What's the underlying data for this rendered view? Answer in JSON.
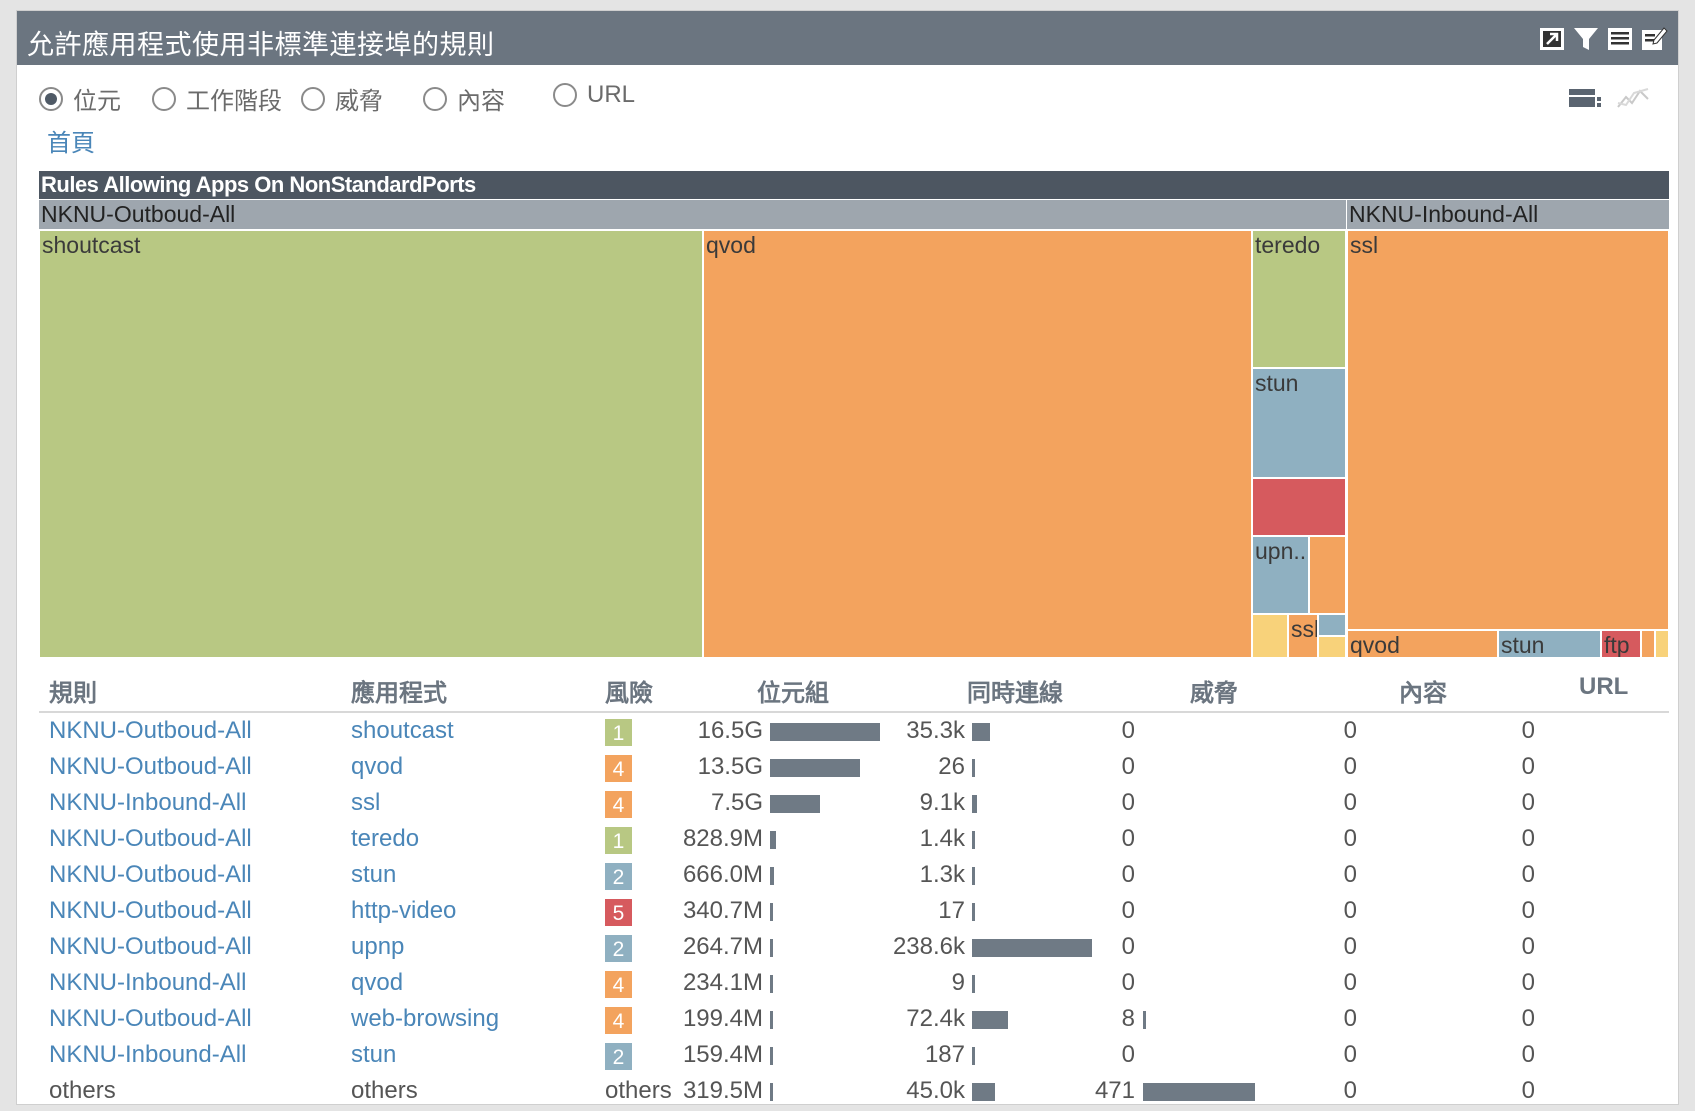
{
  "window": {
    "title": "允許應用程式使用非標準連接埠的規則",
    "icons": [
      "expand-icon",
      "filter-icon",
      "list-icon",
      "edit-icon"
    ]
  },
  "radios": {
    "options": [
      "位元",
      "工作階段",
      "威脅",
      "內容",
      "URL"
    ],
    "selected": "位元"
  },
  "view_icons": [
    "table-view-icon",
    "line-chart-icon"
  ],
  "breadcrumb": {
    "home": "首頁"
  },
  "treemap": {
    "title": "Rules Allowing Apps On NonStandardPorts",
    "groups": [
      "NKNU-Outboud-All",
      "NKNU-Inbound-All"
    ],
    "cell_labels": {
      "shoutcast": "shoutcast",
      "qvod": "qvod",
      "teredo": "teredo",
      "stun": "stun",
      "upnp": "upn..",
      "ssl_small": "ssl",
      "ssl": "ssl",
      "qvod_in": "qvod",
      "stun_in": "stun",
      "ftp": "ftp"
    },
    "colors": {
      "risk1": "#b8c883",
      "risk2": "#8fb0c1",
      "risk4": "#f3a35e",
      "risk5": "#d65a5e",
      "yellow": "#f8d27a"
    }
  },
  "table": {
    "headers": {
      "rule": "規則",
      "app": "應用程式",
      "risk": "風險",
      "bytes": "位元組",
      "sessions": "同時連線",
      "threats": "威脅",
      "content": "內容",
      "url": "URL"
    },
    "rows": [
      {
        "rule": "NKNU-Outboud-All",
        "app": "shoutcast",
        "risk": "1",
        "bytes": "16.5G",
        "bytes_value": 16.5,
        "sessions": "35.3k",
        "sessions_value": 35.3,
        "threats": "0",
        "threats_value": 0,
        "content": "0",
        "url": "0"
      },
      {
        "rule": "NKNU-Outboud-All",
        "app": "qvod",
        "risk": "4",
        "bytes": "13.5G",
        "bytes_value": 13.5,
        "sessions": "26",
        "sessions_value": 0.026,
        "threats": "0",
        "threats_value": 0,
        "content": "0",
        "url": "0"
      },
      {
        "rule": "NKNU-Inbound-All",
        "app": "ssl",
        "risk": "4",
        "bytes": "7.5G",
        "bytes_value": 7.5,
        "sessions": "9.1k",
        "sessions_value": 9.1,
        "threats": "0",
        "threats_value": 0,
        "content": "0",
        "url": "0"
      },
      {
        "rule": "NKNU-Outboud-All",
        "app": "teredo",
        "risk": "1",
        "bytes": "828.9M",
        "bytes_value": 0.8289,
        "sessions": "1.4k",
        "sessions_value": 1.4,
        "threats": "0",
        "threats_value": 0,
        "content": "0",
        "url": "0"
      },
      {
        "rule": "NKNU-Outboud-All",
        "app": "stun",
        "risk": "2",
        "bytes": "666.0M",
        "bytes_value": 0.666,
        "sessions": "1.3k",
        "sessions_value": 1.3,
        "threats": "0",
        "threats_value": 0,
        "content": "0",
        "url": "0"
      },
      {
        "rule": "NKNU-Outboud-All",
        "app": "http-video",
        "risk": "5",
        "bytes": "340.7M",
        "bytes_value": 0.3407,
        "sessions": "17",
        "sessions_value": 0.017,
        "threats": "0",
        "threats_value": 0,
        "content": "0",
        "url": "0"
      },
      {
        "rule": "NKNU-Outboud-All",
        "app": "upnp",
        "risk": "2",
        "bytes": "264.7M",
        "bytes_value": 0.2647,
        "sessions": "238.6k",
        "sessions_value": 238.6,
        "threats": "0",
        "threats_value": 0,
        "content": "0",
        "url": "0"
      },
      {
        "rule": "NKNU-Inbound-All",
        "app": "qvod",
        "risk": "4",
        "bytes": "234.1M",
        "bytes_value": 0.2341,
        "sessions": "9",
        "sessions_value": 0.009,
        "threats": "0",
        "threats_value": 0,
        "content": "0",
        "url": "0"
      },
      {
        "rule": "NKNU-Outboud-All",
        "app": "web-browsing",
        "risk": "4",
        "bytes": "199.4M",
        "bytes_value": 0.1994,
        "sessions": "72.4k",
        "sessions_value": 72.4,
        "threats": "8",
        "threats_value": 8,
        "content": "0",
        "url": "0"
      },
      {
        "rule": "NKNU-Inbound-All",
        "app": "stun",
        "risk": "2",
        "bytes": "159.4M",
        "bytes_value": 0.1594,
        "sessions": "187",
        "sessions_value": 0.187,
        "threats": "0",
        "threats_value": 0,
        "content": "0",
        "url": "0"
      },
      {
        "rule": "others",
        "app": "others",
        "risk": "others",
        "bytes": "319.5M",
        "bytes_value": 0.3195,
        "sessions": "45.0k",
        "sessions_value": 45.0,
        "threats": "471",
        "threats_value": 471,
        "content": "0",
        "url": "0"
      }
    ]
  }
}
